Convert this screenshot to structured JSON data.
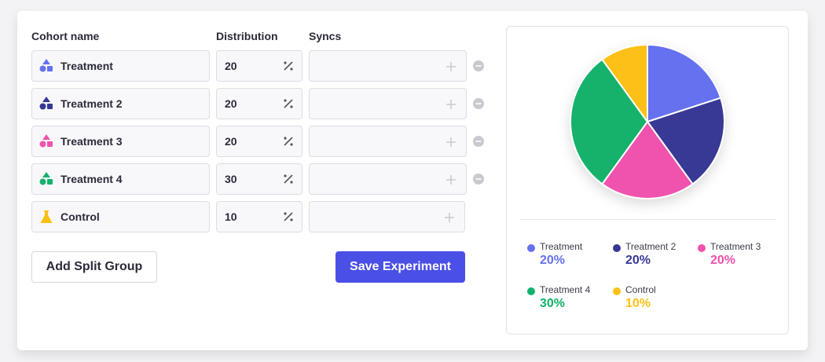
{
  "headers": {
    "cohort_name": "Cohort name",
    "distribution": "Distribution",
    "syncs": "Syncs"
  },
  "cohorts": [
    {
      "name": "Treatment",
      "value": "20",
      "percent": 20,
      "color": "#6571ee",
      "icon": "shapes-icon",
      "removable": true
    },
    {
      "name": "Treatment 2",
      "value": "20",
      "percent": 20,
      "color": "#373895",
      "icon": "shapes-icon",
      "removable": true
    },
    {
      "name": "Treatment 3",
      "value": "20",
      "percent": 20,
      "color": "#f052ad",
      "icon": "shapes-icon",
      "removable": true
    },
    {
      "name": "Treatment 4",
      "value": "30",
      "percent": 30,
      "color": "#13b26c",
      "icon": "shapes-icon",
      "removable": true
    },
    {
      "name": "Control",
      "value": "10",
      "percent": 10,
      "color": "#fdc012",
      "icon": "flask-icon",
      "removable": false
    }
  ],
  "buttons": {
    "add_split_group": "Add Split Group",
    "save_experiment": "Save Experiment"
  },
  "legend": [
    {
      "name": "Treatment",
      "value": "20%",
      "color": "#6571ee"
    },
    {
      "name": "Treatment 2",
      "value": "20%",
      "color": "#373895"
    },
    {
      "name": "Treatment 3",
      "value": "20%",
      "color": "#f052ad"
    },
    {
      "name": "Treatment 4",
      "value": "30%",
      "color": "#13b26c"
    },
    {
      "name": "Control",
      "value": "10%",
      "color": "#fdc012"
    }
  ],
  "chart_data": {
    "type": "pie",
    "categories": [
      "Treatment",
      "Treatment 2",
      "Treatment 3",
      "Treatment 4",
      "Control"
    ],
    "values": [
      20,
      20,
      20,
      30,
      10
    ],
    "colors": [
      "#6571ee",
      "#373895",
      "#f052ad",
      "#13b26c",
      "#fdc012"
    ],
    "title": "",
    "legend_position": "bottom"
  }
}
